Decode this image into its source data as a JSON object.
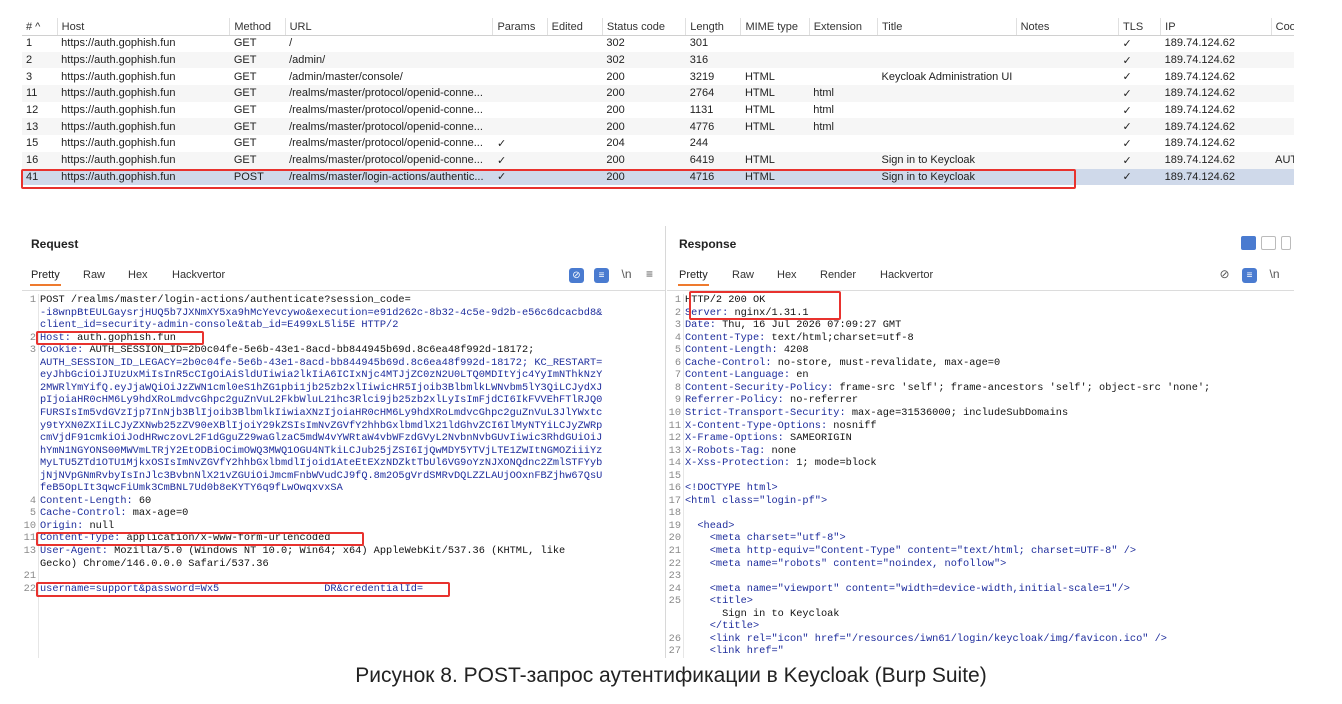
{
  "history": {
    "columns": [
      "# ^",
      "Host",
      "Method",
      "URL",
      "Params",
      "Edited",
      "Status code",
      "Length",
      "MIME type",
      "Extension",
      "Title",
      "Notes",
      "TLS",
      "IP",
      "Cook"
    ],
    "rows": [
      {
        "num": "1",
        "host": "https://auth.gophish.fun",
        "method": "GET",
        "url": "/",
        "params": "",
        "edited": "",
        "status": "302",
        "length": "301",
        "mime": "",
        "ext": "",
        "title": "",
        "notes": "",
        "tls": "✓",
        "ip": "189.74.124.62",
        "cookie": ""
      },
      {
        "num": "2",
        "host": "https://auth.gophish.fun",
        "method": "GET",
        "url": "/admin/",
        "params": "",
        "edited": "",
        "status": "302",
        "length": "316",
        "mime": "",
        "ext": "",
        "title": "",
        "notes": "",
        "tls": "✓",
        "ip": "189.74.124.62",
        "cookie": ""
      },
      {
        "num": "3",
        "host": "https://auth.gophish.fun",
        "method": "GET",
        "url": "/admin/master/console/",
        "params": "",
        "edited": "",
        "status": "200",
        "length": "3219",
        "mime": "HTML",
        "ext": "",
        "title": "Keycloak Administration UI",
        "notes": "",
        "tls": "✓",
        "ip": "189.74.124.62",
        "cookie": ""
      },
      {
        "num": "11",
        "host": "https://auth.gophish.fun",
        "method": "GET",
        "url": "/realms/master/protocol/openid-conne...",
        "params": "",
        "edited": "",
        "status": "200",
        "length": "2764",
        "mime": "HTML",
        "ext": "html",
        "title": "",
        "notes": "",
        "tls": "✓",
        "ip": "189.74.124.62",
        "cookie": ""
      },
      {
        "num": "12",
        "host": "https://auth.gophish.fun",
        "method": "GET",
        "url": "/realms/master/protocol/openid-conne...",
        "params": "",
        "edited": "",
        "status": "200",
        "length": "1131",
        "mime": "HTML",
        "ext": "html",
        "title": "",
        "notes": "",
        "tls": "✓",
        "ip": "189.74.124.62",
        "cookie": ""
      },
      {
        "num": "13",
        "host": "https://auth.gophish.fun",
        "method": "GET",
        "url": "/realms/master/protocol/openid-conne...",
        "params": "",
        "edited": "",
        "status": "200",
        "length": "4776",
        "mime": "HTML",
        "ext": "html",
        "title": "",
        "notes": "",
        "tls": "✓",
        "ip": "189.74.124.62",
        "cookie": ""
      },
      {
        "num": "15",
        "host": "https://auth.gophish.fun",
        "method": "GET",
        "url": "/realms/master/protocol/openid-conne...",
        "params": "✓",
        "edited": "",
        "status": "204",
        "length": "244",
        "mime": "",
        "ext": "",
        "title": "",
        "notes": "",
        "tls": "✓",
        "ip": "189.74.124.62",
        "cookie": ""
      },
      {
        "num": "16",
        "host": "https://auth.gophish.fun",
        "method": "GET",
        "url": "/realms/master/protocol/openid-conne...",
        "params": "✓",
        "edited": "",
        "status": "200",
        "length": "6419",
        "mime": "HTML",
        "ext": "",
        "title": "Sign in to Keycloak",
        "notes": "",
        "tls": "✓",
        "ip": "189.74.124.62",
        "cookie": "AUTH"
      },
      {
        "num": "41",
        "host": "https://auth.gophish.fun",
        "method": "POST",
        "url": "/realms/master/login-actions/authentic...",
        "params": "✓",
        "edited": "",
        "status": "200",
        "length": "4716",
        "mime": "HTML",
        "ext": "",
        "title": "Sign in to Keycloak",
        "notes": "",
        "tls": "✓",
        "ip": "189.74.124.62",
        "cookie": "",
        "selected": true
      }
    ]
  },
  "request": {
    "title": "Request",
    "tabs": [
      "Pretty",
      "Raw",
      "Hex",
      "Hackvertor"
    ],
    "newline_label": "\\n",
    "lines": [
      {
        "n": "1",
        "t": "POST /realms/master/login-actions/authenticate?session_code="
      },
      {
        "n": "",
        "t": "-i8wnpBtEULGaysrjHUQ5b7JXNmXY5xa9hMcYevcywo&execution=e91d262c-8b32-4c5e-9d2b-e56c6dcacbd8&"
      },
      {
        "n": "",
        "t": "client_id=security-admin-console&tab_id=E499xL5li5E HTTP/2"
      },
      {
        "n": "2",
        "t": "Host: auth.gophish.fun"
      },
      {
        "n": "3",
        "t": "Cookie: AUTH_SESSION_ID=2b0c04fe-5e6b-43e1-8acd-bb844945b69d.8c6ea48f992d-18172;"
      },
      {
        "n": "",
        "t": "AUTH_SESSION_ID_LEGACY=2b0c04fe-5e6b-43e1-8acd-bb844945b69d.8c6ea48f992d-18172; KC_RESTART="
      },
      {
        "n": "",
        "t": "eyJhbGciOiJIUzUxMiIsInR5cCIgOiAiSldUIiwia2lkIiA6ICIxNjc4MTJjZC0zN2U0LTQ0MDItYjc4YyImNThkNzY"
      },
      {
        "n": "",
        "t": "2MWRlYmYifQ.eyJjaWQiOiJzZWN1cml0eS1hZG1pbi1jb25zb2xlIiwicHR5Ijoib3BlbmlkLWNvbm5lY3QiLCJydXJ"
      },
      {
        "n": "",
        "t": "pIjoiaHR0cHM6Ly9hdXRoLmdvcGhpc2guZnVuL2FkbWluL21hc3Rlci9jb25zb2xlLyIsImFjdCI6IkFVVEhFTlRJQ0"
      },
      {
        "n": "",
        "t": "FURSIsIm5vdGVzIjp7InNjb3BlIjoib3BlbmlkIiwiaXNzIjoiaHR0cHM6Ly9hdXRoLmdvcGhpc2guZnVuL3JlYWxtc"
      },
      {
        "n": "",
        "t": "y9tYXN0ZXIiLCJyZXNwb25zZV90eXBlIjoiY29kZSIsImNvZGVfY2hhbGxlbmdlX21ldGhvZCI6IlMyNTYiLCJyZWRp"
      },
      {
        "n": "",
        "t": "cmVjdF91cmkiOiJodHRwczovL2F1dGguZ29waGlzaC5mdW4vYWRtaW4vbWFzdGVyL2NvbnNvbGUvIiwic3RhdGUiOiJ"
      },
      {
        "n": "",
        "t": "hYmN1NGYONS00MWVmLTRjY2EtODBiOCimOWQ3MWQ1OGU4NTkiLCJub25jZSI6IjQwMDY5YTVjLTE1ZWItNGMOZiiiYz"
      },
      {
        "n": "",
        "t": "MyLTU5ZTd1OTU1MjkxOSIsImNvZGVfY2hhbGxlbmdlIjoid1AteEtEXzNDZktTbUl6VG9oYzNJXONQdnc2ZmlSTFYyb"
      },
      {
        "n": "",
        "t": "jNjNVpGNmRvbyIsInJlc3BvbnNlX21vZGUiOiJmcmFnbWVudCJ9fQ.8m2O5gVrdSMRvDQLZZLAUjOOxnFBZjhw67QsU"
      },
      {
        "n": "",
        "t": "feB5OpLIt3qwcFiUmk3CmBNL7Ud0b8eKYTY6q9fLwOwqxvxSA"
      },
      {
        "n": "4",
        "t": "Content-Length: 60"
      },
      {
        "n": "5",
        "t": "Cache-Control: max-age=0"
      },
      {
        "n": "10",
        "t": "Origin: null"
      },
      {
        "n": "11",
        "t": "Content-Type: application/x-www-form-urlencoded"
      },
      {
        "n": "13",
        "t": "User-Agent: Mozilla/5.0 (Windows NT 10.0; Win64; x64) AppleWebKit/537.36 (KHTML, like"
      },
      {
        "n": "",
        "t": "Gecko) Chrome/146.0.0.0 Safari/537.36"
      },
      {
        "n": "21",
        "t": ""
      },
      {
        "n": "22",
        "t": "username=support&password=Wx5                 DR&credentialId="
      }
    ]
  },
  "response": {
    "title": "Response",
    "tabs": [
      "Pretty",
      "Raw",
      "Hex",
      "Render",
      "Hackvertor"
    ],
    "newline_label": "\\n",
    "lines": [
      {
        "n": "1",
        "t": "HTTP/2 200 OK"
      },
      {
        "n": "2",
        "t": "Server: nginx/1.31.1"
      },
      {
        "n": "3",
        "t": "Date: Thu, 16 Jul 2026 07:09:27 GMT"
      },
      {
        "n": "4",
        "t": "Content-Type: text/html;charset=utf-8"
      },
      {
        "n": "5",
        "t": "Content-Length: 4208"
      },
      {
        "n": "6",
        "t": "Cache-Control: no-store, must-revalidate, max-age=0"
      },
      {
        "n": "7",
        "t": "Content-Language: en"
      },
      {
        "n": "8",
        "t": "Content-Security-Policy: frame-src 'self'; frame-ancestors 'self'; object-src 'none';"
      },
      {
        "n": "9",
        "t": "Referrer-Policy: no-referrer"
      },
      {
        "n": "10",
        "t": "Strict-Transport-Security: max-age=31536000; includeSubDomains"
      },
      {
        "n": "11",
        "t": "X-Content-Type-Options: nosniff"
      },
      {
        "n": "12",
        "t": "X-Frame-Options: SAMEORIGIN"
      },
      {
        "n": "13",
        "t": "X-Robots-Tag: none"
      },
      {
        "n": "14",
        "t": "X-Xss-Protection: 1; mode=block"
      },
      {
        "n": "15",
        "t": ""
      },
      {
        "n": "16",
        "t": "<!DOCTYPE html>"
      },
      {
        "n": "17",
        "t": "<html class=\"login-pf\">"
      },
      {
        "n": "18",
        "t": ""
      },
      {
        "n": "19",
        "t": "  <head>"
      },
      {
        "n": "20",
        "t": "    <meta charset=\"utf-8\">"
      },
      {
        "n": "21",
        "t": "    <meta http-equiv=\"Content-Type\" content=\"text/html; charset=UTF-8\" />"
      },
      {
        "n": "22",
        "t": "    <meta name=\"robots\" content=\"noindex, nofollow\">"
      },
      {
        "n": "23",
        "t": ""
      },
      {
        "n": "24",
        "t": "    <meta name=\"viewport\" content=\"width=device-width,initial-scale=1\"/>"
      },
      {
        "n": "25",
        "t": "    <title>"
      },
      {
        "n": "",
        "t": "      Sign in to Keycloak"
      },
      {
        "n": "",
        "t": "    </title>"
      },
      {
        "n": "26",
        "t": "    <link rel=\"icon\" href=\"/resources/iwn61/login/keycloak/img/favicon.ico\" />"
      },
      {
        "n": "27",
        "t": "    <link href=\""
      }
    ]
  },
  "caption": "Рисунок 8. POST-запрос аутентификации в Keycloak (Burp Suite)"
}
